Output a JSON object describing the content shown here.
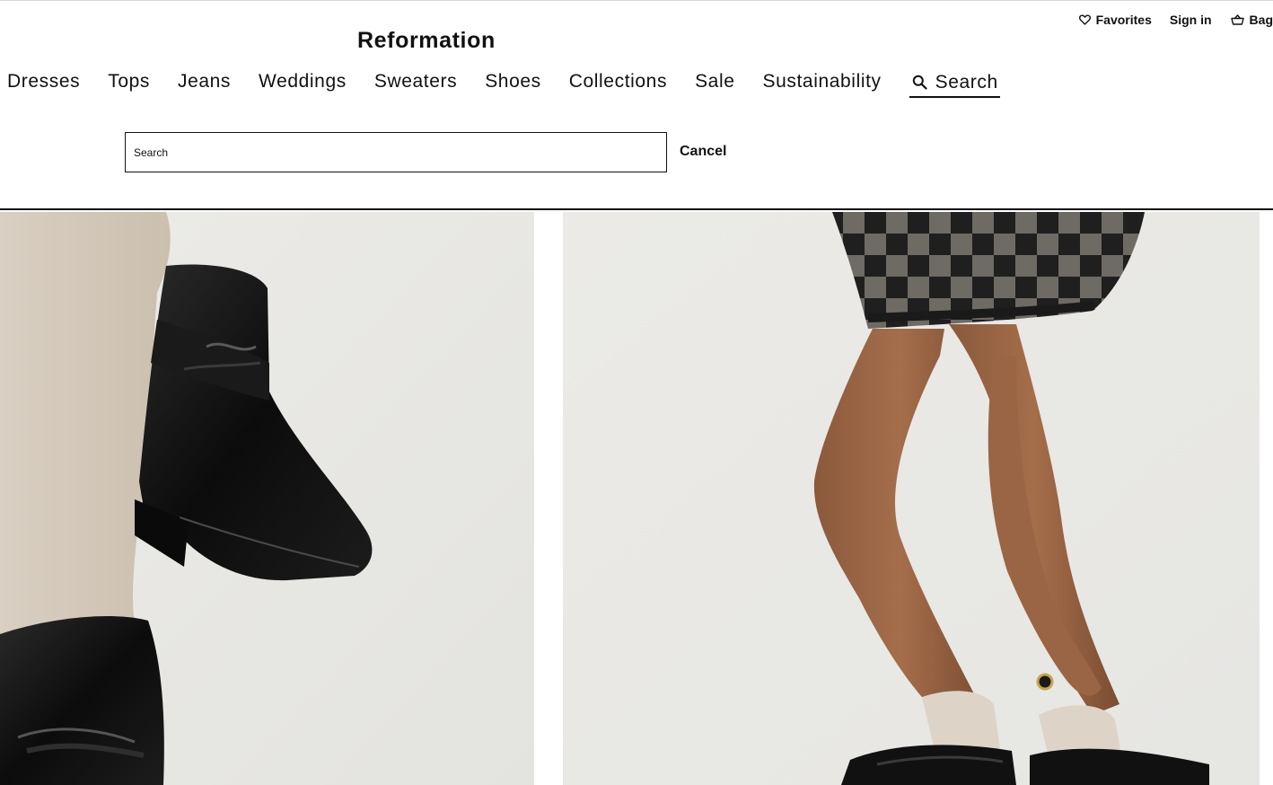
{
  "utility": {
    "favorites_label": "Favorites",
    "signin_label": "Sign in",
    "bag_label": "Bag",
    "favorites_icon": "heart-icon",
    "bag_icon": "basket-icon"
  },
  "brand": {
    "logo_text": "Reformation"
  },
  "nav": {
    "items": [
      {
        "label": "Dresses"
      },
      {
        "label": "Tops"
      },
      {
        "label": "Jeans"
      },
      {
        "label": "Weddings"
      },
      {
        "label": "Sweaters"
      },
      {
        "label": "Shoes"
      },
      {
        "label": "Collections"
      },
      {
        "label": "Sale"
      },
      {
        "label": "Sustainability"
      }
    ],
    "search_label": "Search",
    "search_icon": "magnifier-icon"
  },
  "search": {
    "placeholder": "Search",
    "value": "",
    "cancel_label": "Cancel"
  },
  "colors": {
    "text": "#111111",
    "background": "#ffffff",
    "photo_backdrop": "#efefec"
  },
  "images": [
    {
      "subject": "black penny loafer with beige sock, close-up"
    },
    {
      "subject": "model legs wearing checked shorts, beige socks and black loafers"
    }
  ]
}
